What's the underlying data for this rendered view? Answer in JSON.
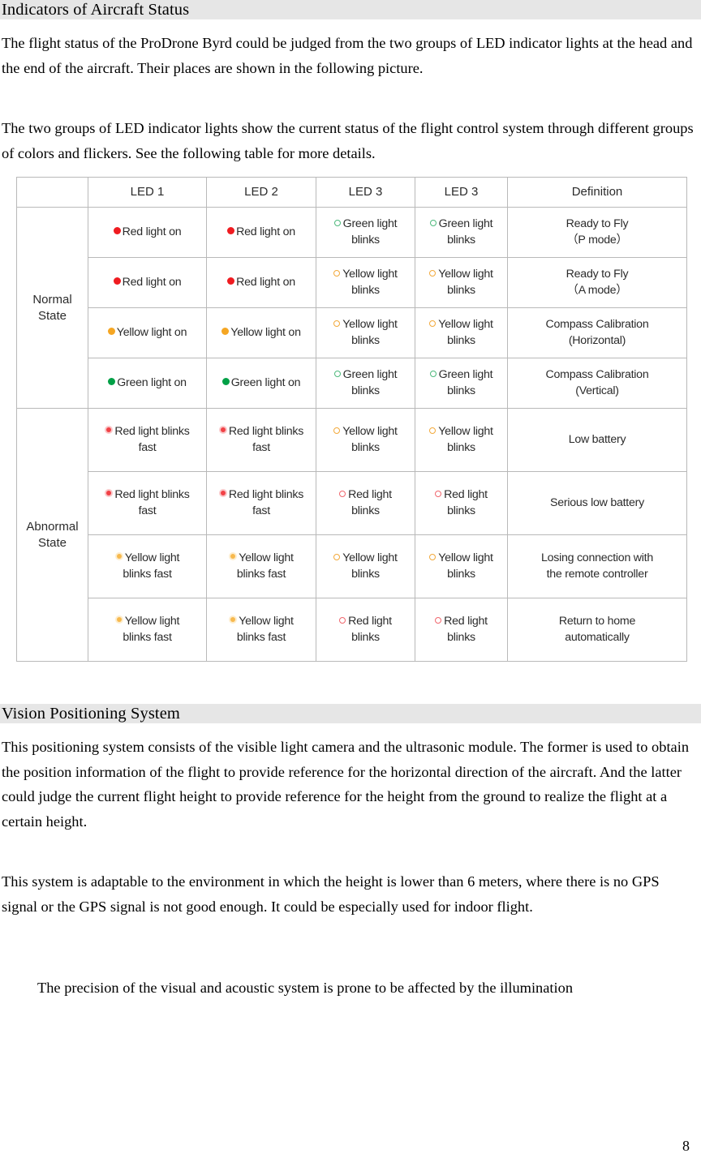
{
  "sections": {
    "indicators": {
      "heading": "Indicators of Aircraft Status",
      "para1": "The flight status of the ProDrone Byrd could be judged from the two groups of LED indicator lights at the head and the end of the aircraft. Their places are shown in the following picture.",
      "para2": "The two groups of LED indicator lights show the current status of the flight control system through different groups of colors and flickers. See the following table for more details."
    },
    "vision": {
      "heading": "Vision Positioning System",
      "para1": "This positioning system consists of the visible light camera and the ultrasonic module. The former is used to obtain the position information of the flight to provide reference for the horizontal direction of the aircraft. And the latter could judge the current flight height to provide reference for the height from the ground to realize the flight at a certain height.",
      "para2": "This system is adaptable to the environment in which the height is lower than 6 meters, where there is no GPS signal or the GPS signal is not good enough. It could be especially used for indoor flight.",
      "para3": "The precision of the visual and acoustic system is prone to be affected by the illumination"
    }
  },
  "led_table": {
    "headers": {
      "state": "",
      "led1": "LED 1",
      "led2": "LED 2",
      "led3a": "LED 3",
      "led3b": "LED 3",
      "definition": "Definition"
    },
    "state_labels": {
      "normal_line1": "Normal",
      "normal_line2": "State",
      "abnormal_line1": "Abnormal",
      "abnormal_line2": "State"
    },
    "rows": [
      {
        "group": "normal",
        "led1": {
          "marker": "solid-red-dot",
          "line1": "Red light on",
          "line2": ""
        },
        "led2": {
          "marker": "solid-red-dot",
          "line1": "Red light on",
          "line2": ""
        },
        "led3a": {
          "marker": "green-ring",
          "line1": "Green light",
          "line2": "blinks"
        },
        "led3b": {
          "marker": "green-ring",
          "line1": "Green light",
          "line2": "blinks"
        },
        "definition_line1": "Ready to Fly",
        "definition_line2": "（P mode）"
      },
      {
        "group": "normal",
        "led1": {
          "marker": "solid-red-dot",
          "line1": "Red light on",
          "line2": ""
        },
        "led2": {
          "marker": "solid-red-dot",
          "line1": "Red light on",
          "line2": ""
        },
        "led3a": {
          "marker": "yellow-ring",
          "line1": "Yellow light",
          "line2": "blinks"
        },
        "led3b": {
          "marker": "yellow-ring",
          "line1": "Yellow light",
          "line2": "blinks"
        },
        "definition_line1": "Ready to Fly",
        "definition_line2": "（A mode）"
      },
      {
        "group": "normal",
        "led1": {
          "marker": "solid-yellow-dot",
          "line1": "Yellow light on",
          "line2": ""
        },
        "led2": {
          "marker": "solid-yellow-dot",
          "line1": "Yellow light on",
          "line2": ""
        },
        "led3a": {
          "marker": "yellow-ring",
          "line1": "Yellow light",
          "line2": "blinks"
        },
        "led3b": {
          "marker": "yellow-ring",
          "line1": "Yellow light",
          "line2": "blinks"
        },
        "definition_line1": "Compass Calibration",
        "definition_line2": "(Horizontal)"
      },
      {
        "group": "normal",
        "led1": {
          "marker": "solid-green-dot",
          "line1": "Green light on",
          "line2": ""
        },
        "led2": {
          "marker": "solid-green-dot",
          "line1": "Green light on",
          "line2": ""
        },
        "led3a": {
          "marker": "green-ring",
          "line1": "Green light",
          "line2": "blinks"
        },
        "led3b": {
          "marker": "green-ring",
          "line1": "Green light",
          "line2": "blinks"
        },
        "definition_line1": "Compass Calibration",
        "definition_line2": "(Vertical)"
      },
      {
        "group": "abnormal",
        "led1": {
          "marker": "red-burst",
          "line1": "Red light blinks",
          "line2": "fast"
        },
        "led2": {
          "marker": "red-burst",
          "line1": "Red light blinks",
          "line2": "fast"
        },
        "led3a": {
          "marker": "yellow-ring",
          "line1": "Yellow light",
          "line2": "blinks"
        },
        "led3b": {
          "marker": "yellow-ring",
          "line1": "Yellow light",
          "line2": "blinks"
        },
        "definition_line1": "Low battery",
        "definition_line2": ""
      },
      {
        "group": "abnormal",
        "led1": {
          "marker": "red-burst",
          "line1": "Red light blinks",
          "line2": "fast"
        },
        "led2": {
          "marker": "red-burst",
          "line1": "Red light blinks",
          "line2": "fast"
        },
        "led3a": {
          "marker": "red-ring",
          "line1": "Red light",
          "line2": "blinks"
        },
        "led3b": {
          "marker": "red-ring",
          "line1": "Red light",
          "line2": "blinks"
        },
        "definition_line1": "Serious low battery",
        "definition_line2": ""
      },
      {
        "group": "abnormal",
        "led1": {
          "marker": "yellow-burst",
          "line1": "Yellow light",
          "line2": "blinks fast"
        },
        "led2": {
          "marker": "yellow-burst",
          "line1": "Yellow light",
          "line2": "blinks fast"
        },
        "led3a": {
          "marker": "yellow-ring",
          "line1": "Yellow light",
          "line2": "blinks"
        },
        "led3b": {
          "marker": "yellow-ring",
          "line1": "Yellow light",
          "line2": "blinks"
        },
        "definition_line1": "Losing connection with",
        "definition_line2": "the remote controller"
      },
      {
        "group": "abnormal",
        "led1": {
          "marker": "yellow-burst",
          "line1": "Yellow light",
          "line2": "blinks fast"
        },
        "led2": {
          "marker": "yellow-burst",
          "line1": "Yellow light",
          "line2": "blinks fast"
        },
        "led3a": {
          "marker": "red-ring",
          "line1": "Red light",
          "line2": "blinks"
        },
        "led3b": {
          "marker": "red-ring",
          "line1": "Red light",
          "line2": "blinks"
        },
        "definition_line1": "Return to home",
        "definition_line2": "automatically"
      }
    ]
  },
  "footer": {
    "page_number": "8"
  },
  "colors": {
    "heading_bar": "#e6e6e6",
    "table_border": "#b9b9b9",
    "led_red": "#ef1b20",
    "led_yellow": "#f5a623",
    "led_green": "#00a046",
    "text": "#000000"
  }
}
